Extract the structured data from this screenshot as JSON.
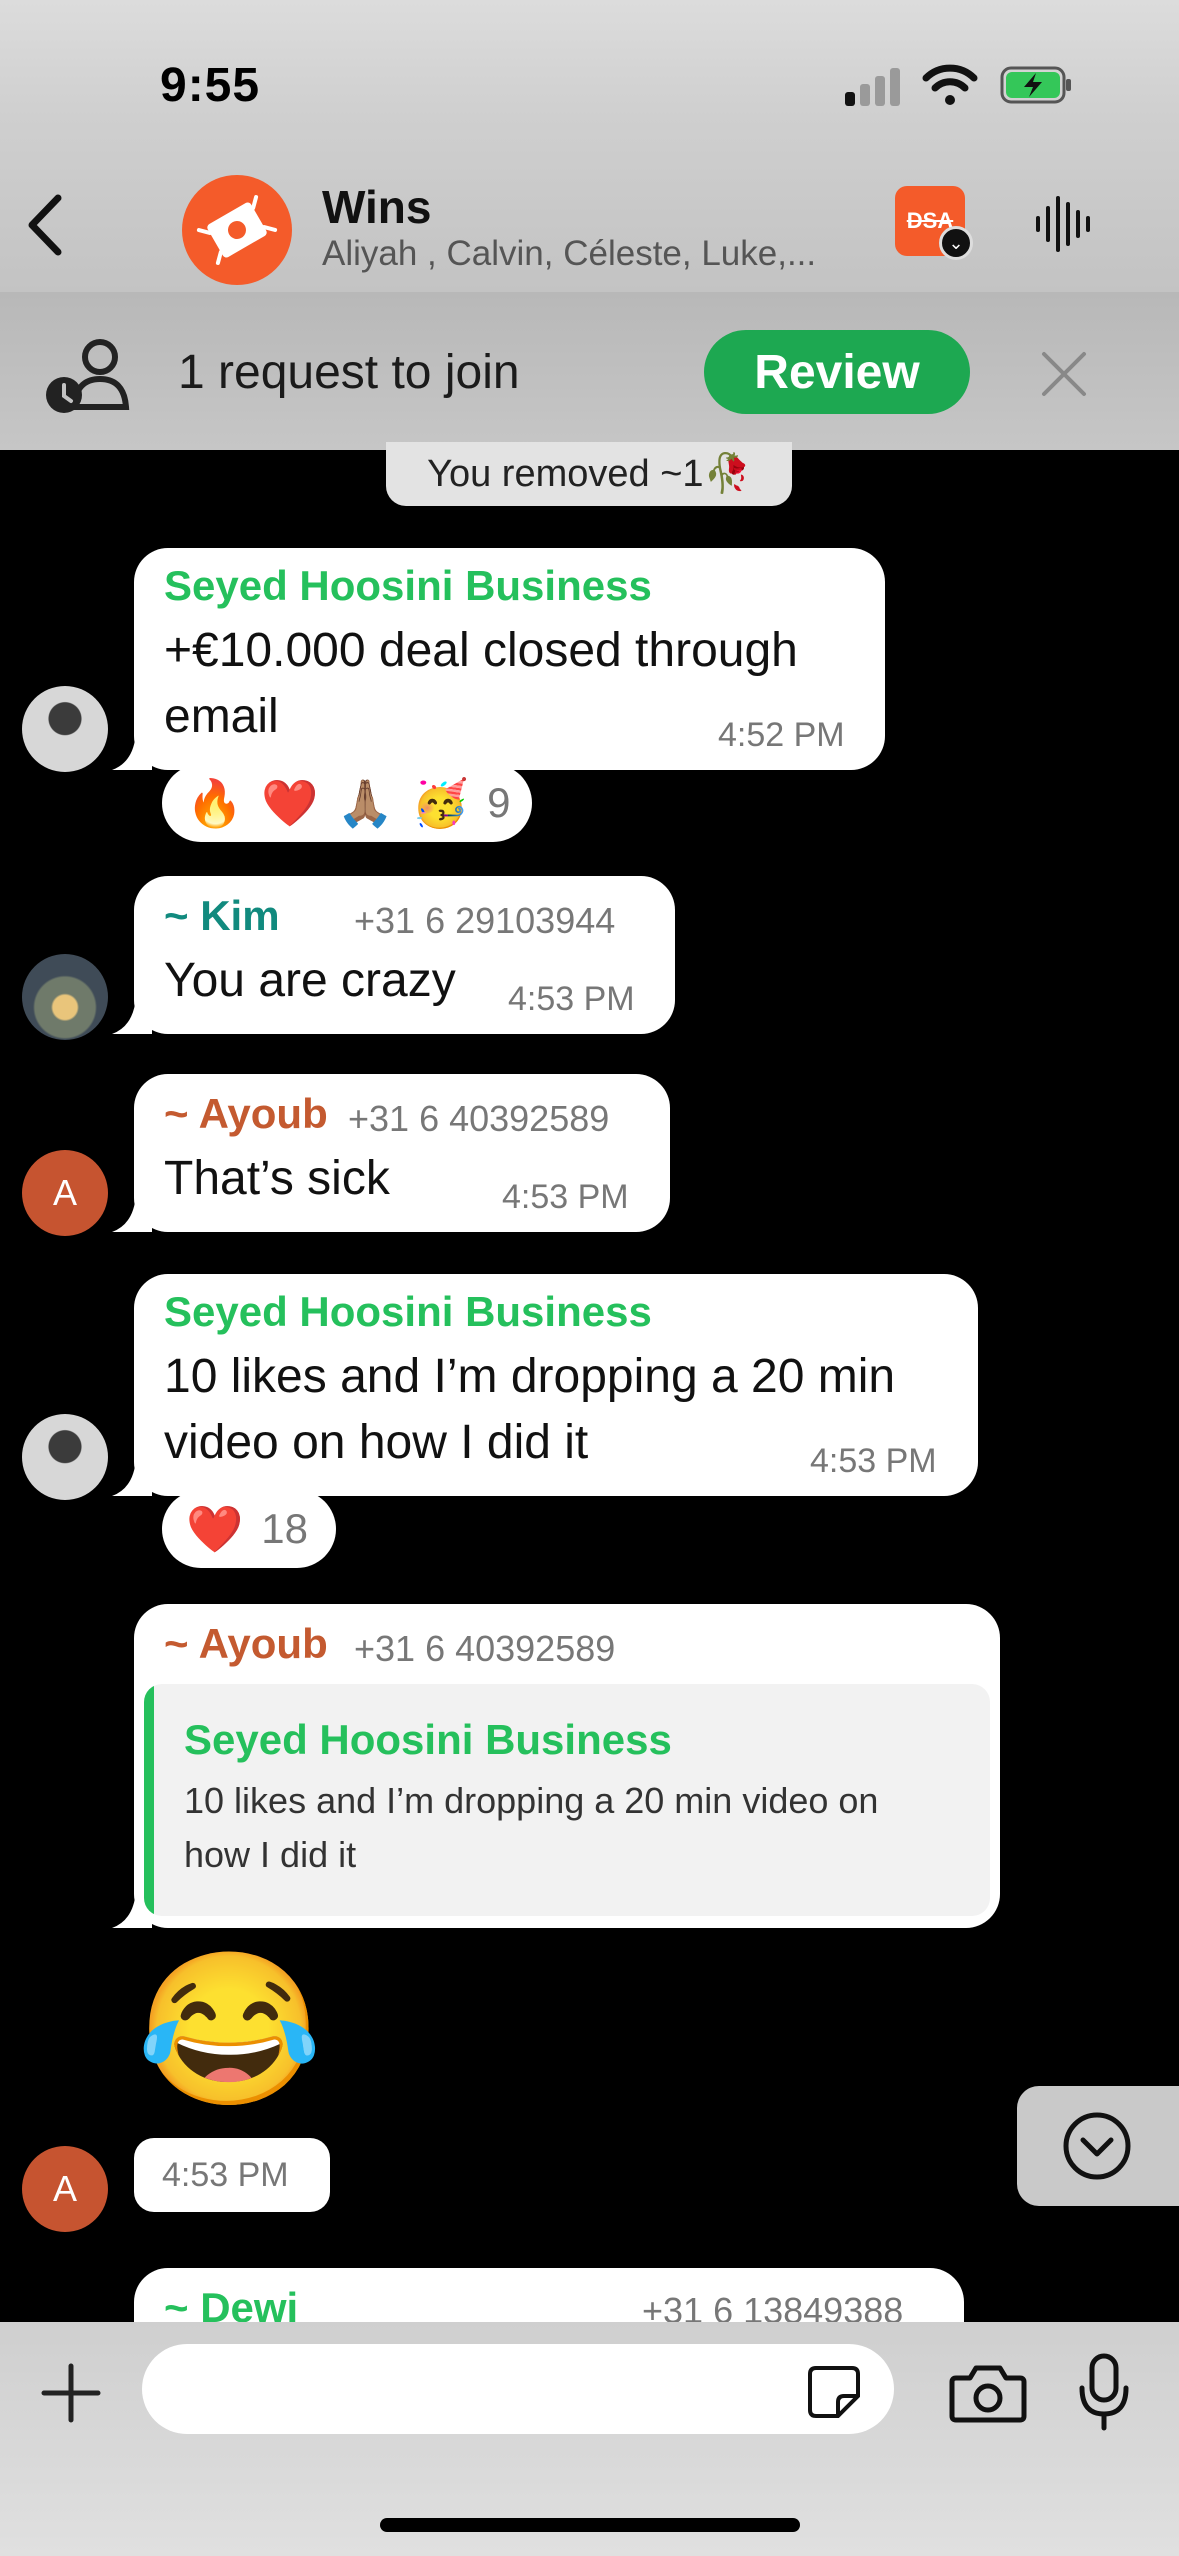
{
  "status_bar": {
    "time": "9:55"
  },
  "header": {
    "title": "Wins",
    "subtitle": "Aliyah , Calvin, Céleste, Luke,...",
    "badge_text": "DSA"
  },
  "banner": {
    "text": "1 request to join",
    "review_label": "Review"
  },
  "system_note": "You removed ~1🥀",
  "messages": [
    {
      "sender": "Seyed Hoosini Business",
      "line1": "+€10.000 deal closed through",
      "line2": "email",
      "time": "4:52 PM",
      "reactions": [
        "🔥",
        "❤️",
        "🙏🏽",
        "🥳"
      ],
      "reaction_count": "9"
    },
    {
      "sender": "~ Kim",
      "phone": "+31 6 29103944",
      "text": "You are crazy",
      "time": "4:53 PM"
    },
    {
      "sender": "~ Ayoub",
      "phone": "+31 6 40392589",
      "text": "That’s sick",
      "time": "4:53 PM",
      "avatar_letter": "A"
    },
    {
      "sender": "Seyed Hoosini Business",
      "line1": "10 likes and I’m dropping a 20 min",
      "line2": "video on how I did it",
      "time": "4:53 PM",
      "reactions": [
        "❤️"
      ],
      "reaction_count": "18"
    },
    {
      "sender": "~ Ayoub",
      "phone": "+31 6 40392589",
      "quote_sender": "Seyed Hoosini Business",
      "quote_line1": "10 likes and I’m dropping a 20 min video on",
      "quote_line2": "how I did it",
      "emoji": "😂",
      "time": "4:53 PM",
      "avatar_letter": "A"
    },
    {
      "sender": "~ Dewi",
      "phone": "+31 6 13849388"
    }
  ],
  "composer": {
    "placeholder": ""
  },
  "colors": {
    "green": "#25c05c",
    "teal": "#118a7e",
    "orange": "#c45a30",
    "review_green": "#1da851",
    "battery_green": "#34c759"
  }
}
